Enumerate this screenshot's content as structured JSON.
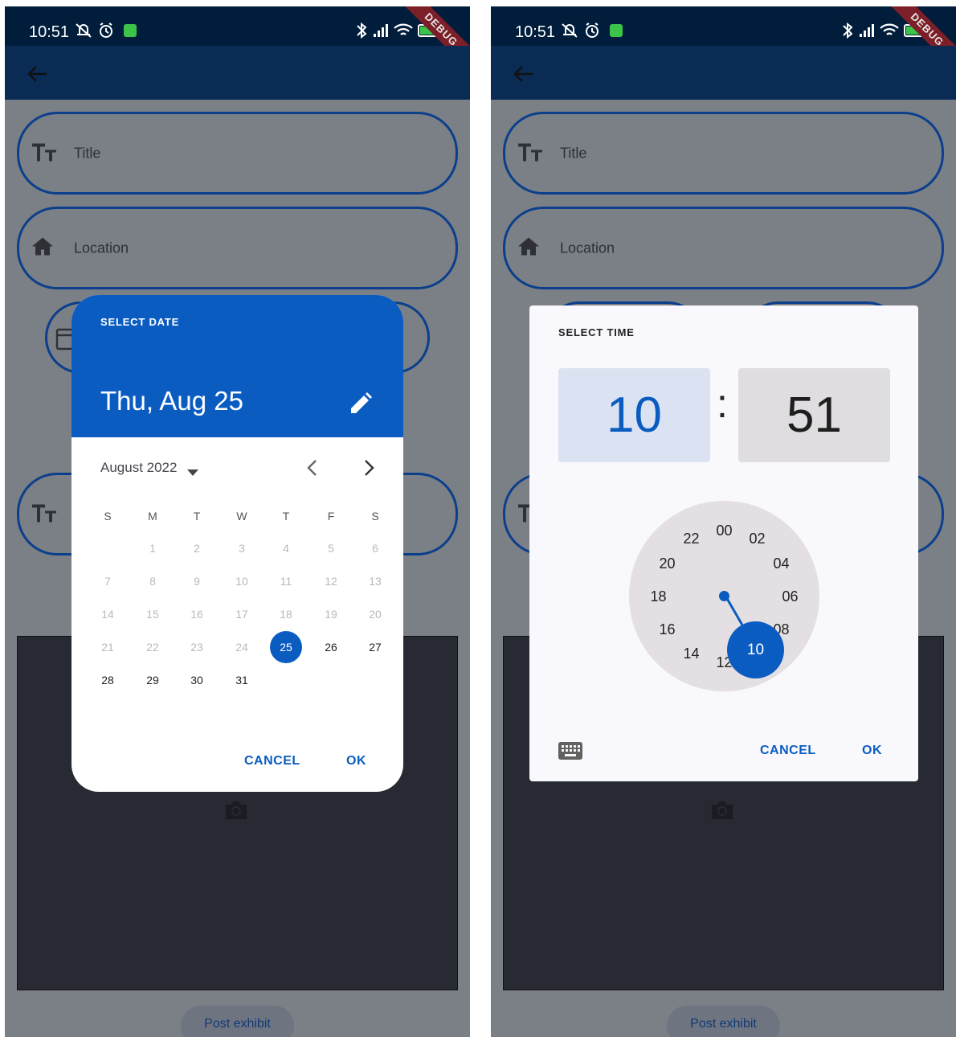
{
  "status_bar": {
    "time": "10:51",
    "debug_banner": "DEBUG"
  },
  "form": {
    "title_placeholder": "Title",
    "location_placeholder": "Location",
    "post_button": "Post exhibit"
  },
  "date_picker": {
    "header_label": "SELECT DATE",
    "selected_date": "Thu, Aug 25",
    "month_label": "August 2022",
    "weekdays": [
      "S",
      "M",
      "T",
      "W",
      "T",
      "F",
      "S"
    ],
    "days": [
      "1",
      "2",
      "3",
      "4",
      "5",
      "6",
      "7",
      "8",
      "9",
      "10",
      "11",
      "12",
      "13",
      "14",
      "15",
      "16",
      "17",
      "18",
      "19",
      "20",
      "21",
      "22",
      "23",
      "24",
      "25",
      "26",
      "27",
      "28",
      "29",
      "30",
      "31"
    ],
    "selected_day": "25",
    "cancel_label": "CANCEL",
    "ok_label": "OK"
  },
  "time_picker": {
    "header_label": "SELECT TIME",
    "hour": "10",
    "separator": ":",
    "minute": "51",
    "dial_labels": [
      "00",
      "02",
      "04",
      "06",
      "08",
      "10",
      "12",
      "14",
      "16",
      "18",
      "20",
      "22"
    ],
    "selected_hour_label": "10",
    "cancel_label": "CANCEL",
    "ok_label": "OK"
  }
}
